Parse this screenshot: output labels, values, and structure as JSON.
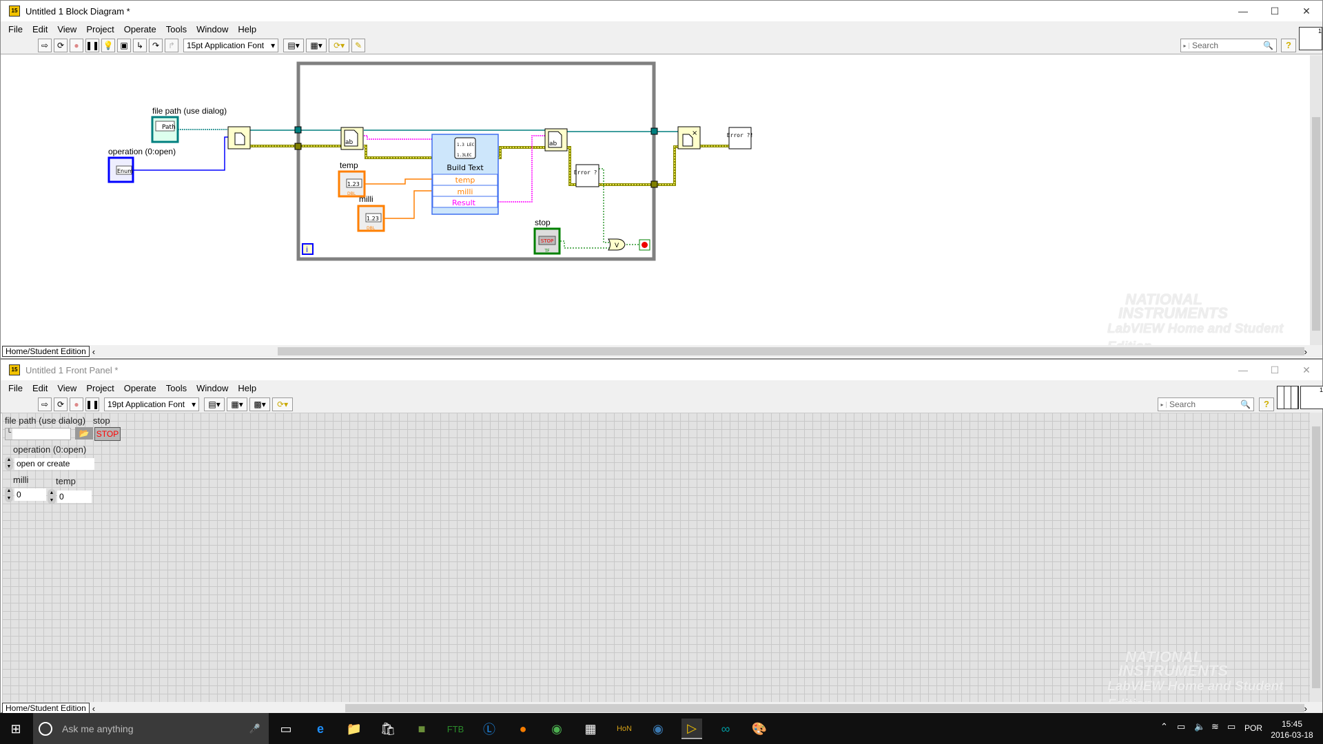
{
  "block_diagram": {
    "title": "Untitled 1 Block Diagram *",
    "menu": [
      "File",
      "Edit",
      "View",
      "Project",
      "Operate",
      "Tools",
      "Window",
      "Help"
    ],
    "font_selector": "15pt Application Font",
    "search_placeholder": "Search",
    "edition_label": "Home/Student Edition",
    "nodes": {
      "file_path_label": "file path (use dialog)",
      "file_path_terminal": "Path",
      "operation_label": "operation (0:open)",
      "operation_terminal": "Enum",
      "temp_label": "temp",
      "milli_label": "milli",
      "numeric_terminal": "1.23",
      "numeric_type": "DBL",
      "stop_label": "stop",
      "stop_terminal": "STOP",
      "bool_type": "TF",
      "build_text_title": "Build Text",
      "build_text_inputs": [
        "temp",
        "milli"
      ],
      "build_text_output": "Result",
      "error_handler": "Error ?!",
      "or_symbol": "V",
      "iteration": "i"
    },
    "wire_colors": {
      "refnum": "#007f7f",
      "error": "#c8c800",
      "string": "#ff00ff",
      "numeric": "#ff7f00",
      "boolean": "#008000",
      "enum": "#0000ff"
    }
  },
  "front_panel": {
    "title": "Untitled 1 Front Panel *",
    "menu": [
      "File",
      "Edit",
      "View",
      "Project",
      "Operate",
      "Tools",
      "Window",
      "Help"
    ],
    "font_selector": "19pt Application Font",
    "search_placeholder": "Search",
    "edition_label": "Home/Student Edition",
    "controls": {
      "file_path_label": "file path (use dialog)",
      "file_path_value": "",
      "stop_label": "stop",
      "stop_button": "STOP",
      "operation_label": "operation (0:open)",
      "operation_value": "open or create",
      "milli_label": "milli",
      "milli_value": "0",
      "temp_label": "temp",
      "temp_value": "0"
    }
  },
  "watermark": {
    "brand_line1": "NATIONAL",
    "brand_line2": "INSTRUMENTS",
    "edition": "LabVIEW Home and Student Edition"
  },
  "taskbar": {
    "search_placeholder": "Ask me anything",
    "apps": [
      "task-view",
      "edge",
      "file-explorer",
      "store",
      "minecraft",
      "ftb",
      "app-g",
      "firefox",
      "chrome",
      "calendar-app",
      "hon",
      "steam",
      "labview",
      "arduino",
      "paint"
    ],
    "language": "POR",
    "time": "15:45",
    "date": "2016-03-18"
  }
}
